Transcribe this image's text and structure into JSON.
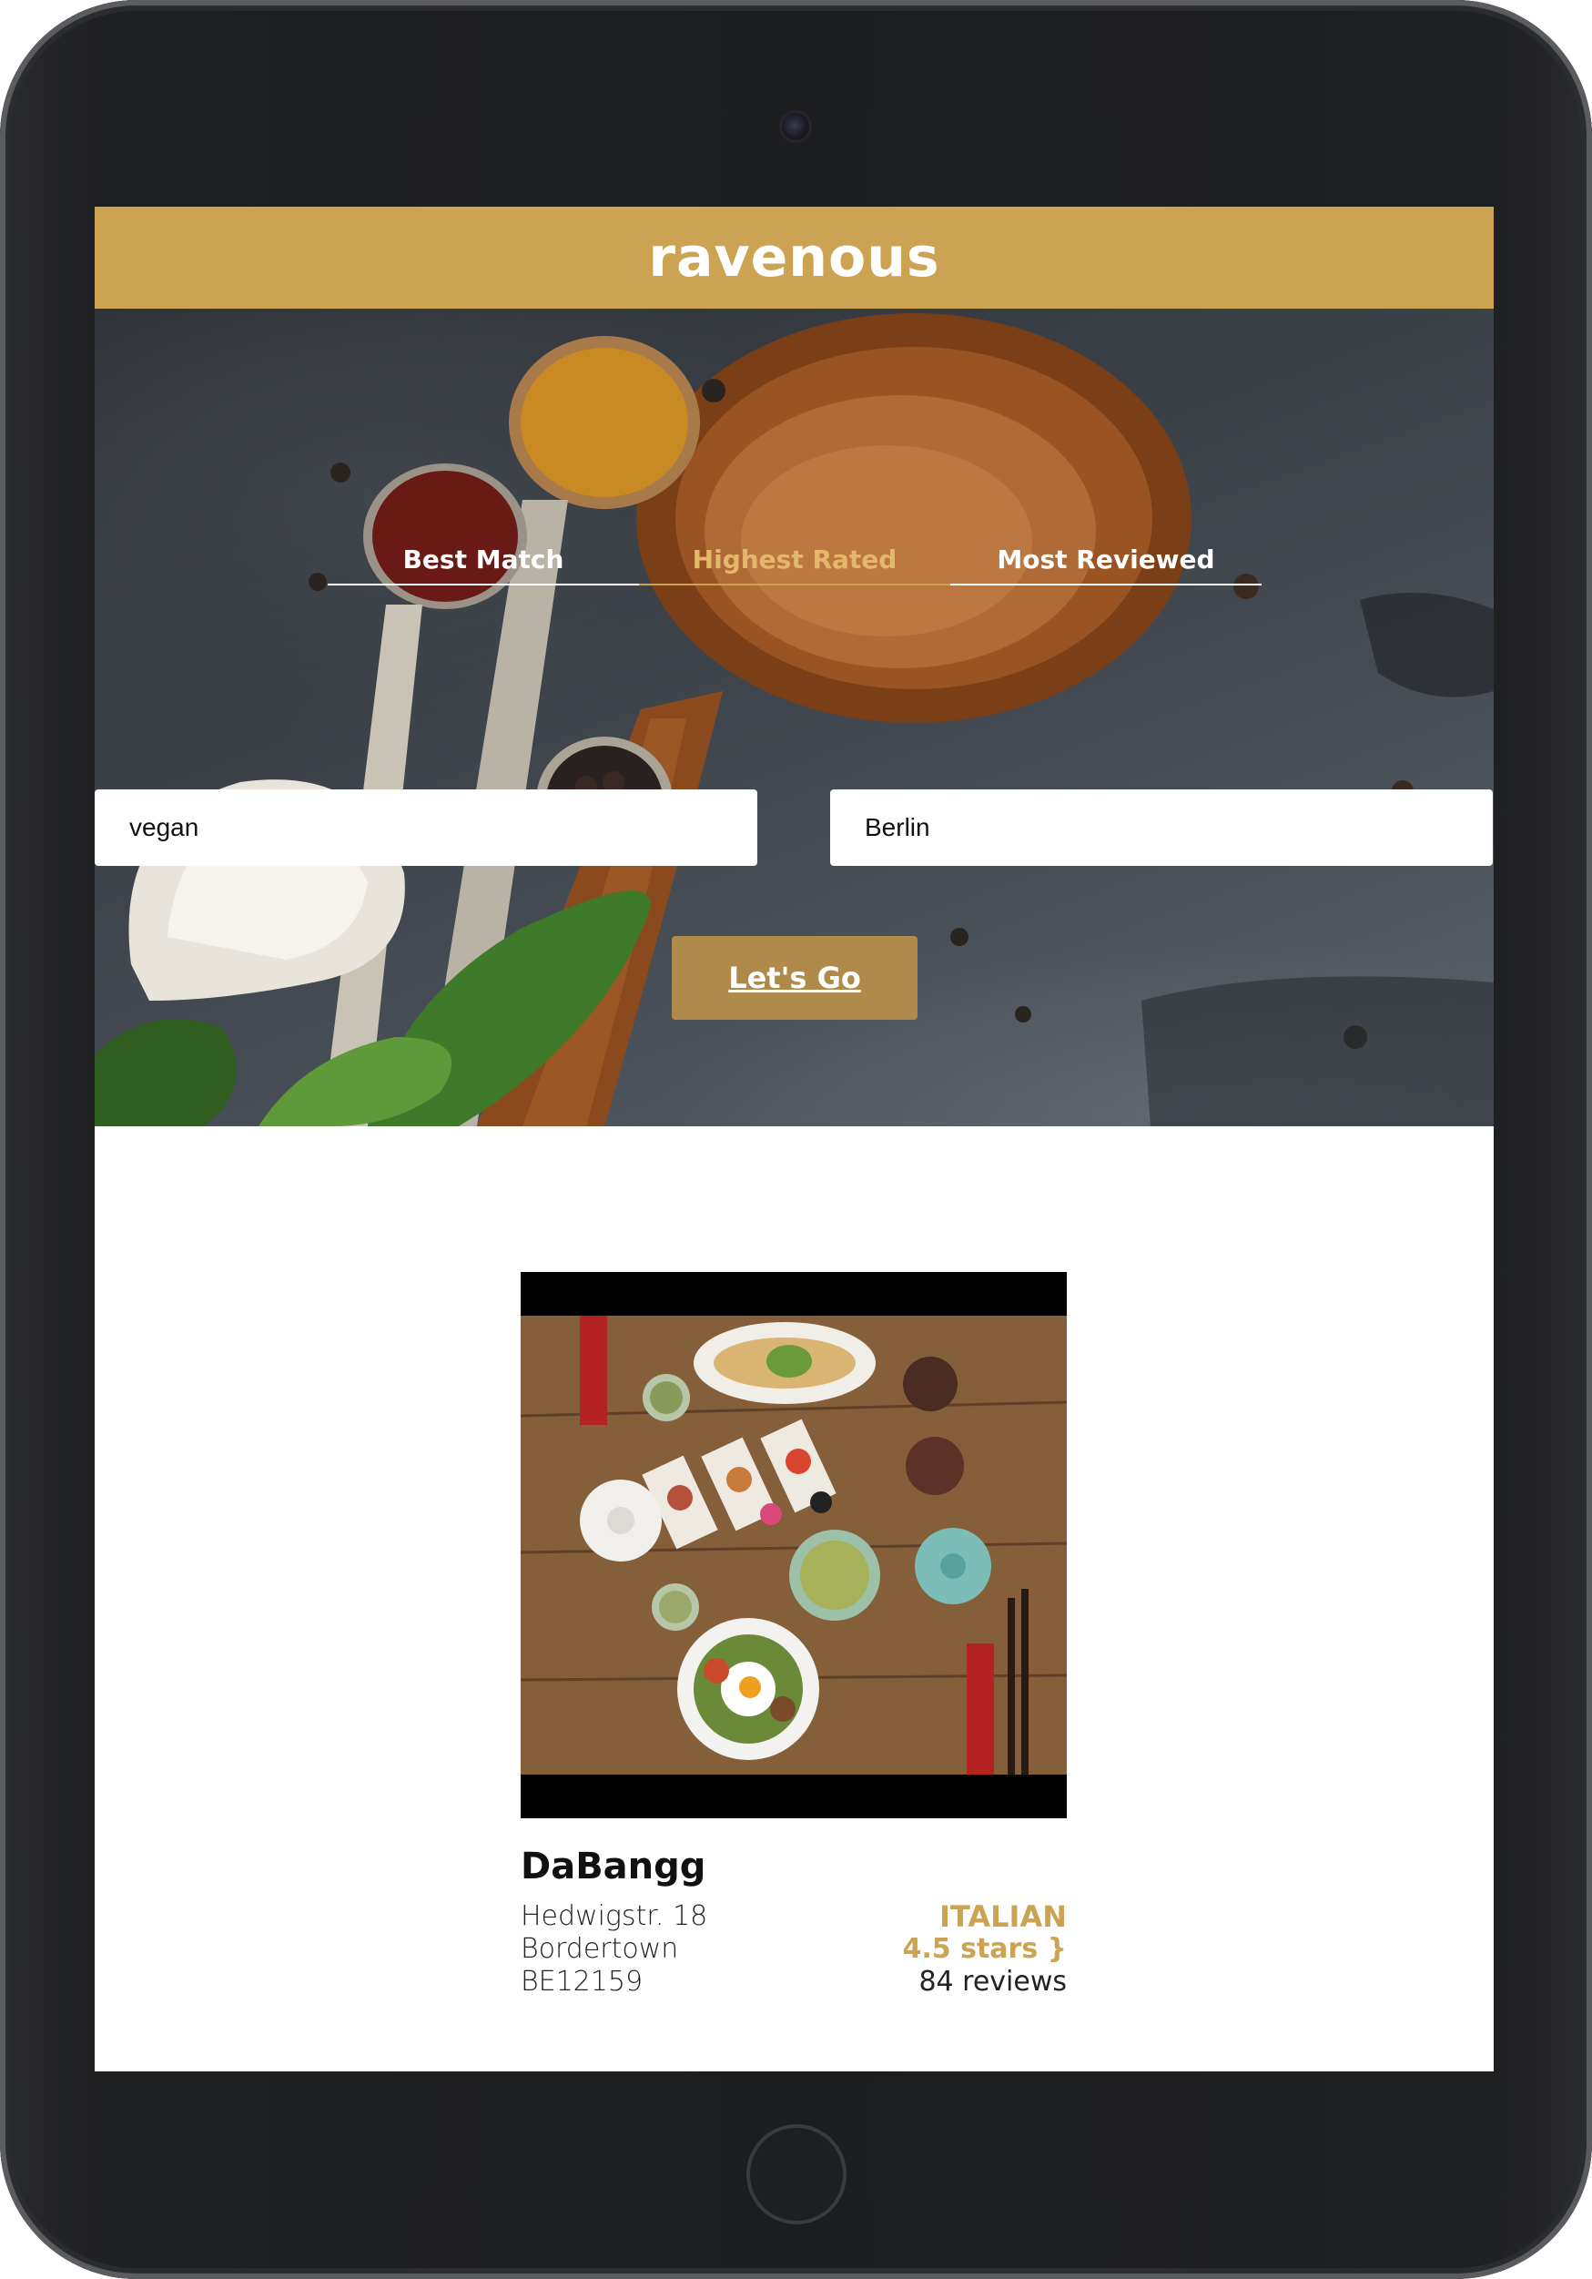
{
  "app": {
    "brand": "ravenous"
  },
  "sort_options": [
    {
      "label": "Best Match",
      "active": false
    },
    {
      "label": "Highest Rated",
      "active": true
    },
    {
      "label": "Most Reviewed",
      "active": false
    }
  ],
  "search": {
    "term_value": "vegan",
    "location_value": "Berlin",
    "submit_label": "Let's Go"
  },
  "business": {
    "name": "DaBangg",
    "address_line1": "Hedwigstr. 18",
    "city": "Bordertown",
    "zip": "BE12159",
    "category": "ITALIAN",
    "rating": "4.5 stars }",
    "review_count": "84 reviews"
  },
  "colors": {
    "accent": "#cca352",
    "button": "#b08a4a",
    "active_tab": "#e4b86a"
  }
}
